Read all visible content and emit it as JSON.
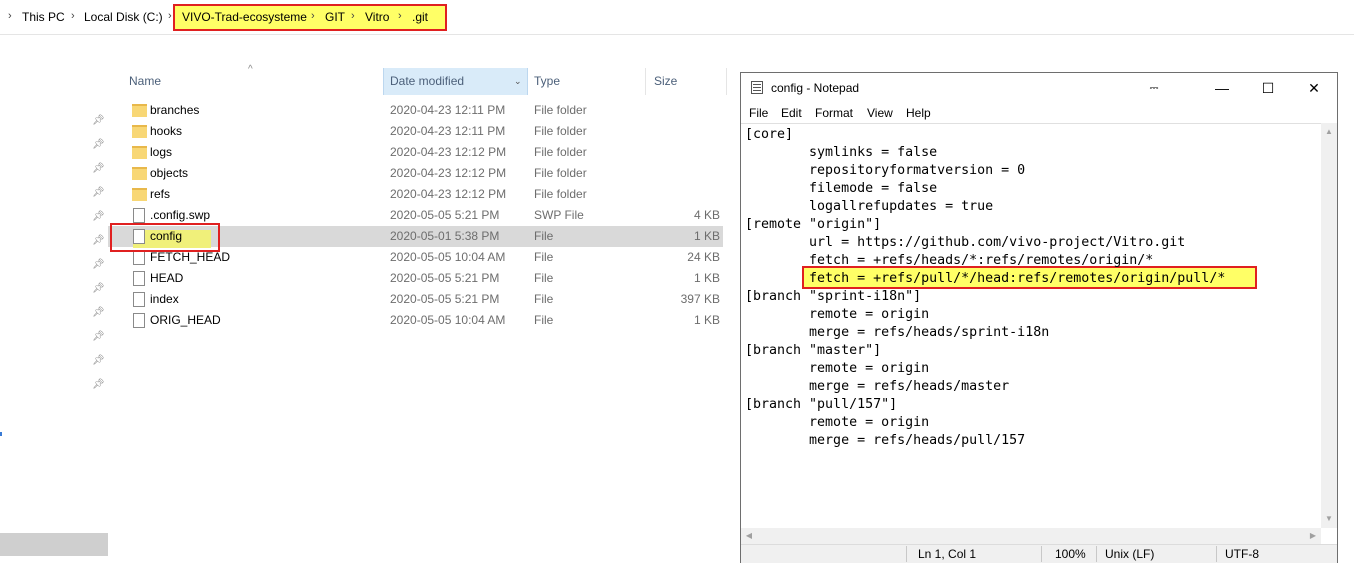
{
  "breadcrumb": {
    "items": [
      "This PC",
      "Local Disk (C:)",
      "VIVO-Trad-ecosysteme",
      "GIT",
      "Vitro",
      ".git"
    ]
  },
  "file_list": {
    "columns": {
      "name": "Name",
      "date": "Date modified",
      "type": "Type",
      "size": "Size"
    },
    "rows": [
      {
        "name": "branches",
        "date": "2020-04-23 12:11 PM",
        "type": "File folder",
        "size": "",
        "icon": "folder-icon"
      },
      {
        "name": "hooks",
        "date": "2020-04-23 12:11 PM",
        "type": "File folder",
        "size": "",
        "icon": "folder-icon"
      },
      {
        "name": "logs",
        "date": "2020-04-23 12:12 PM",
        "type": "File folder",
        "size": "",
        "icon": "folder-icon"
      },
      {
        "name": "objects",
        "date": "2020-04-23 12:12 PM",
        "type": "File folder",
        "size": "",
        "icon": "folder-icon"
      },
      {
        "name": "refs",
        "date": "2020-04-23 12:12 PM",
        "type": "File folder",
        "size": "",
        "icon": "folder-icon"
      },
      {
        "name": ".config.swp",
        "date": "2020-05-05 5:21 PM",
        "type": "SWP File",
        "size": "4 KB",
        "icon": "file-icon"
      },
      {
        "name": "config",
        "date": "2020-05-01 5:38 PM",
        "type": "File",
        "size": "1 KB",
        "icon": "file-icon",
        "selected": true
      },
      {
        "name": "FETCH_HEAD",
        "date": "2020-05-05 10:04 AM",
        "type": "File",
        "size": "24 KB",
        "icon": "file-icon"
      },
      {
        "name": "HEAD",
        "date": "2020-05-05 5:21 PM",
        "type": "File",
        "size": "1 KB",
        "icon": "file-icon"
      },
      {
        "name": "index",
        "date": "2020-05-05 5:21 PM",
        "type": "File",
        "size": "397 KB",
        "icon": "file-icon"
      },
      {
        "name": "ORIG_HEAD",
        "date": "2020-05-05 10:04 AM",
        "type": "File",
        "size": "1 KB",
        "icon": "file-icon"
      }
    ]
  },
  "notepad": {
    "title": "config - Notepad",
    "menu": [
      "File",
      "Edit",
      "Format",
      "View",
      "Help"
    ],
    "lines": [
      "[core]",
      "\tsymlinks = false",
      "\trepositoryformatversion = 0",
      "\tfilemode = false",
      "\tlogallrefupdates = true",
      "[remote \"origin\"]",
      "\turl = https://github.com/vivo-project/Vitro.git",
      "\tfetch = +refs/heads/*:refs/remotes/origin/*",
      "\tfetch = +refs/pull/*/head:refs/remotes/origin/pull/*",
      "[branch \"sprint-i18n\"]",
      "\tremote = origin",
      "\tmerge = refs/heads/sprint-i18n",
      "[branch \"master\"]",
      "\tremote = origin",
      "\tmerge = refs/heads/master",
      "[branch \"pull/157\"]",
      "\tremote = origin",
      "\tmerge = refs/heads/pull/157"
    ],
    "status": {
      "position": "Ln 1, Col 1",
      "zoom": "100%",
      "line_endings": "Unix (LF)",
      "encoding": "UTF-8"
    }
  },
  "colors": {
    "highlight_yellow": "#ffff66",
    "highlight_border": "#e02020",
    "selected_row": "#d9d9d9",
    "sorted_header": "#d9ebf9"
  }
}
